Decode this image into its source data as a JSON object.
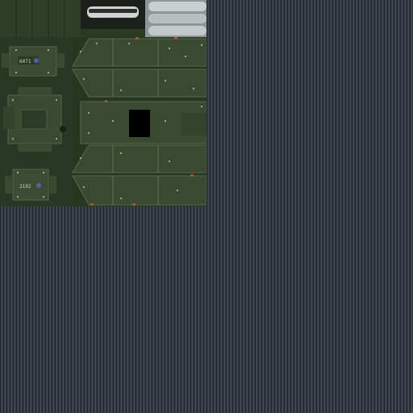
{
  "texture": {
    "colors": {
      "background_stripe_dark": "#1c2126",
      "background_stripe_light": "#48505a",
      "panel_green": "#2c3a24",
      "panel_green_light": "#3a4a30",
      "rivet": "#9aa58a",
      "cylinder_grey": "#b9c0c2",
      "rust_marks": "#a0582a",
      "hatch_black": "#000000"
    },
    "badges": [
      {
        "label": "6071"
      },
      {
        "label": "2192"
      }
    ]
  }
}
